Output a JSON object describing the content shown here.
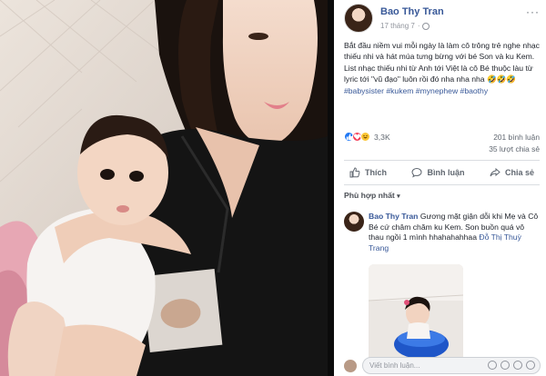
{
  "post": {
    "author": "Bao Thy Tran",
    "date": "17 tháng 7",
    "more_label": "···",
    "text_line_1": "Bắt đầu niềm vui mỗi ngày là làm cô trông trẻ nghe nhạc thiếu nhi và hát múa tưng bừng với bé Son và ku Kem. List nhạc thiếu nhi từ Anh tới Việt là cô Bé thuộc làu từ lyric tới \"vũ đạo\" luôn rồi đó nha nha nha 🤣🤣🤣",
    "hashtags": "#babysister #kukem #mynephew #baothy"
  },
  "stats": {
    "reactions_count": "3,3K",
    "comments_count": "201 bình luận",
    "shares_count": "35 lượt chia sẻ",
    "reaction_icons": [
      "like-icon",
      "love-icon",
      "haha-icon"
    ]
  },
  "actions": {
    "like_label": "Thích",
    "comment_label": "Bình luận",
    "share_label": "Chia sẻ"
  },
  "comments": {
    "sort_label": "Phù hợp nhất",
    "items": [
      {
        "author": "Bao Thy Tran",
        "text": "Gương mặt giận dỗi khi Mẹ và Cô Bé cứ châm chăm ku Kem. Son buồn quá vô thau ngồi 1 mình hhahahahhaa",
        "tag": "Đỗ Thị Thuỳ Trang"
      }
    ]
  },
  "composer": {
    "placeholder": "Viết bình luận..."
  },
  "colors": {
    "link": "#385898",
    "like": "#2078f4",
    "love": "#f33e58",
    "haha": "#fcc533"
  }
}
